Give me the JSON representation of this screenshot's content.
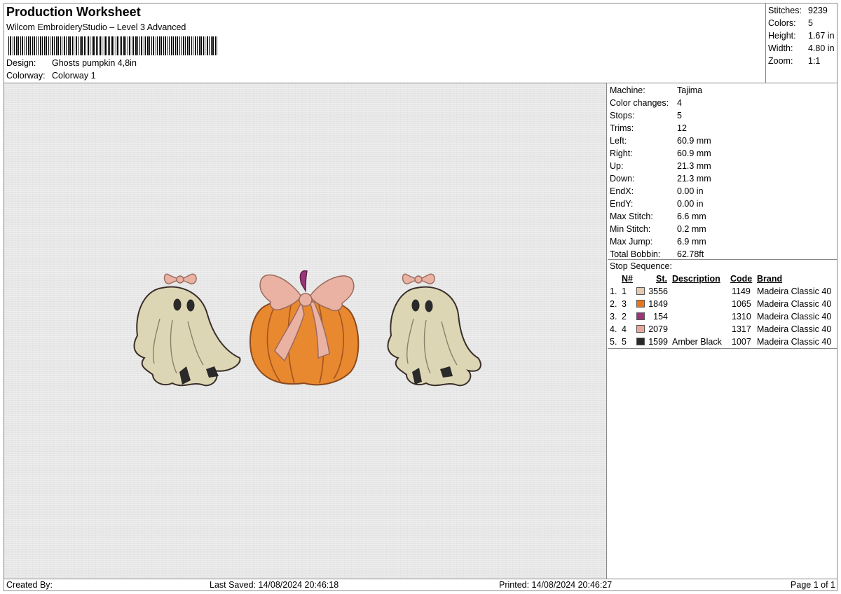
{
  "header": {
    "title": "Production Worksheet",
    "subtitle": "Wilcom EmbroideryStudio – Level 3 Advanced",
    "design_label": "Design:",
    "design_value": "Ghosts pumpkin 4,8in",
    "colorway_label": "Colorway:",
    "colorway_value": "Colorway 1"
  },
  "stats": [
    {
      "label": "Stitches:",
      "value": "9239"
    },
    {
      "label": "Colors:",
      "value": "5"
    },
    {
      "label": "Height:",
      "value": "1.67 in"
    },
    {
      "label": "Width:",
      "value": "4.80 in"
    },
    {
      "label": "Zoom:",
      "value": "1:1"
    }
  ],
  "machine": [
    {
      "label": "Machine:",
      "value": "Tajima"
    },
    {
      "label": "Color changes:",
      "value": "4"
    },
    {
      "label": "Stops:",
      "value": "5"
    },
    {
      "label": "Trims:",
      "value": "12"
    },
    {
      "label": "Left:",
      "value": "60.9 mm"
    },
    {
      "label": "Right:",
      "value": "60.9 mm"
    },
    {
      "label": "Up:",
      "value": "21.3 mm"
    },
    {
      "label": "Down:",
      "value": "21.3 mm"
    },
    {
      "label": "EndX:",
      "value": "0.00 in"
    },
    {
      "label": "EndY:",
      "value": "0.00 in"
    },
    {
      "label": "Max Stitch:",
      "value": "6.6 mm"
    },
    {
      "label": "Min Stitch:",
      "value": "0.2 mm"
    },
    {
      "label": "Max Jump:",
      "value": "6.9 mm"
    },
    {
      "label": "Total Bobbin:",
      "value": "62.78ft"
    }
  ],
  "stop_sequence": {
    "label": "Stop Sequence:",
    "columns": [
      "N#",
      "St.",
      "Description",
      "Code",
      "Brand"
    ],
    "rows": [
      {
        "index": "1.",
        "n": "1",
        "color": "#e3c9b0",
        "stitches": "3556",
        "description": "",
        "code": "1149",
        "brand": "Madeira Classic 40"
      },
      {
        "index": "2.",
        "n": "3",
        "color": "#e8761c",
        "stitches": "1849",
        "description": "",
        "code": "1065",
        "brand": "Madeira Classic 40"
      },
      {
        "index": "3.",
        "n": "2",
        "color": "#9c3578",
        "stitches": "154",
        "description": "",
        "code": "1310",
        "brand": "Madeira Classic 40"
      },
      {
        "index": "4.",
        "n": "4",
        "color": "#e9a79b",
        "stitches": "2079",
        "description": "",
        "code": "1317",
        "brand": "Madeira Classic 40"
      },
      {
        "index": "5.",
        "n": "5",
        "color": "#2a2a2a",
        "stitches": "1599",
        "description": "Amber Black",
        "code": "1007",
        "brand": "Madeira Classic 40"
      }
    ]
  },
  "footer": {
    "created_by": "Created By:",
    "last_saved": "Last Saved: 14/08/2024 20:46:18",
    "printed": "Printed: 14/08/2024 20:46:27",
    "page": "Page 1 of 1"
  },
  "design_colors": {
    "ghost_fill": "#ddd6b4",
    "ghost_outline": "#3a2e2a",
    "bow_fill": "#e9b2a2",
    "bow_outline": "#9b6a5e",
    "pumpkin_fill": "#e8882f",
    "pumpkin_outline": "#8a4a20",
    "stem": "#9c3578",
    "black": "#2a2a2a"
  }
}
